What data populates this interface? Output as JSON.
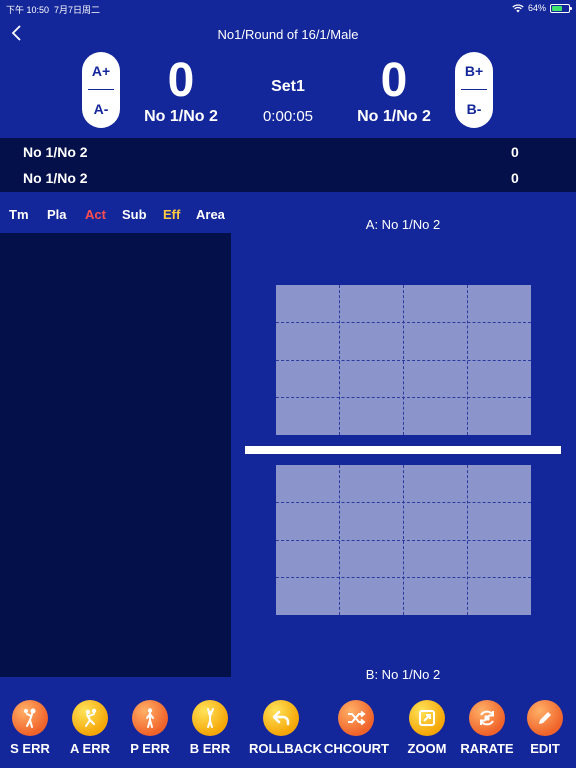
{
  "status_bar": {
    "time": "下午 10:50",
    "date": "7月7日周二",
    "battery": "64%"
  },
  "header": {
    "title": "No1/Round of 16/1/Male"
  },
  "scoreboard": {
    "team_a": {
      "plus": "A+",
      "minus": "A-",
      "score": "0",
      "name": "No 1/No 2"
    },
    "team_b": {
      "plus": "B+",
      "minus": "B-",
      "score": "0",
      "name": "No 1/No 2"
    },
    "set": "Set1",
    "timer": "0:00:05"
  },
  "score_rows": [
    {
      "name": "No 1/No 2",
      "points": "0"
    },
    {
      "name": "No 1/No 2",
      "points": "0"
    }
  ],
  "tabs": [
    {
      "label": "Tm",
      "color": "#ffffff"
    },
    {
      "label": "Pla",
      "color": "#ffffff"
    },
    {
      "label": "Act",
      "color": "#ff4d4d"
    },
    {
      "label": "Sub",
      "color": "#ffffff"
    },
    {
      "label": "Eff",
      "color": "#ffc940"
    },
    {
      "label": "Area",
      "color": "#ffffff"
    }
  ],
  "court": {
    "top_label": "A: No 1/No 2",
    "bottom_label": "B: No 1/No 2"
  },
  "toolbar": [
    {
      "label": "S ERR",
      "icon": "serve-player-icon"
    },
    {
      "label": "A ERR",
      "icon": "attack-player-icon"
    },
    {
      "label": "P ERR",
      "icon": "pass-player-icon"
    },
    {
      "label": "B ERR",
      "icon": "block-player-icon"
    },
    {
      "label": "ROLLBACK",
      "icon": "undo-arrow-icon"
    },
    {
      "label": "CHCOURT",
      "icon": "shuffle-icon"
    },
    {
      "label": "ZOOM",
      "icon": "zoom-icon"
    },
    {
      "label": "RARATE",
      "icon": "rotate-icon"
    },
    {
      "label": "EDIT",
      "icon": "pencil-icon"
    }
  ],
  "colors": {
    "background": "#14279a",
    "panel": "#04104a",
    "court": "#8b95cb",
    "accent_orange": "#f0632a",
    "accent_gold": "#f5a607"
  }
}
